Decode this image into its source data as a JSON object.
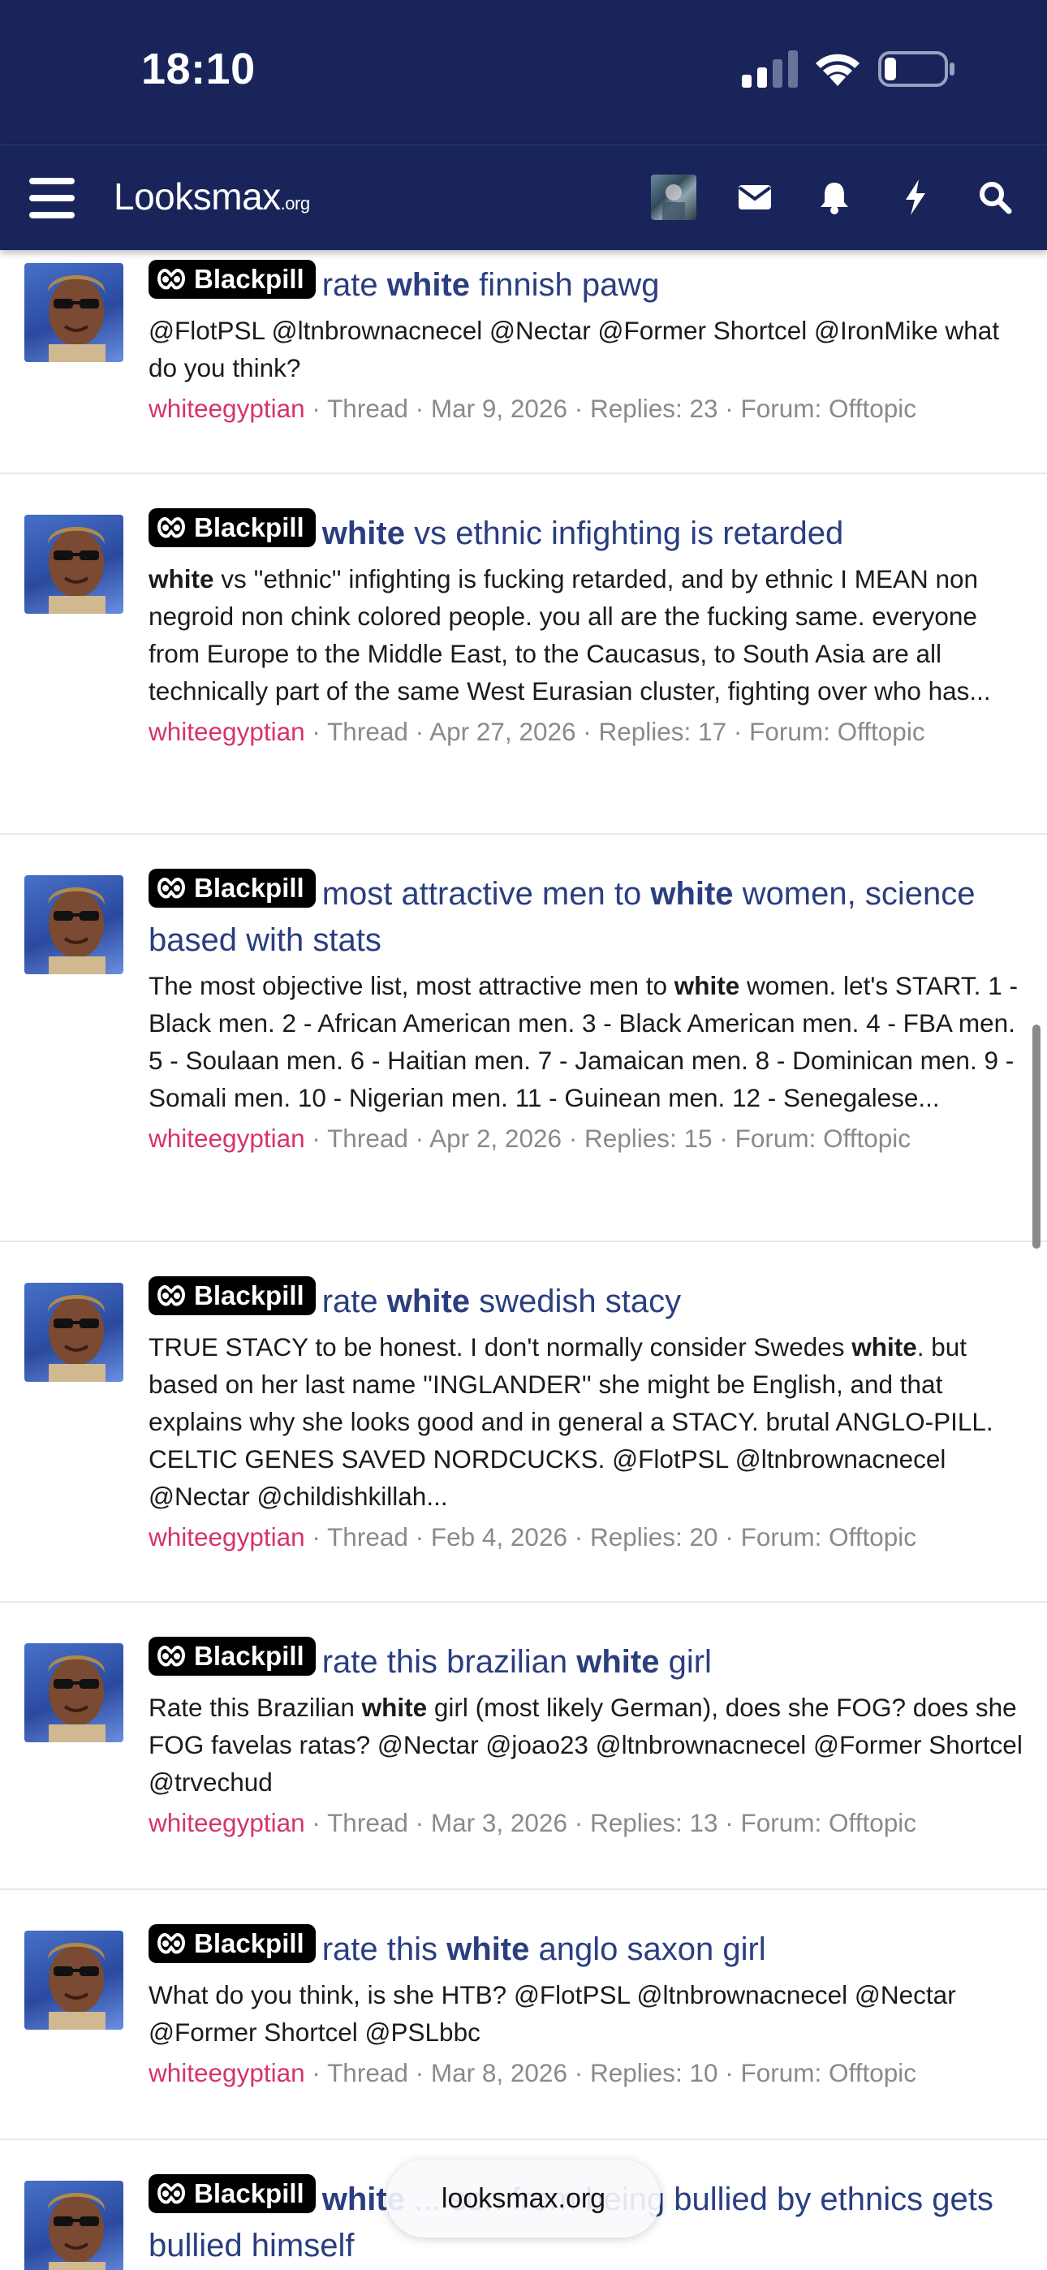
{
  "status": {
    "time": "18:10"
  },
  "header": {
    "logo_main": "Looksmax",
    "logo_suffix": ".org"
  },
  "tag_label": "Blackpill",
  "items": [
    {
      "title": [
        {
          "t": "rate "
        },
        {
          "t": "white",
          "b": true
        },
        {
          "t": " finnish pawg"
        }
      ],
      "snippet": [
        {
          "t": "@FlotPSL @ltnbrownacnecel @Nectar @Former Shortcel @IronMike what do you think?"
        }
      ],
      "author": "whiteegyptian",
      "meta": " · Thread · Mar 9, 2026 · Replies: 23 · Forum: Offtopic"
    },
    {
      "title": [
        {
          "t": "white",
          "b": true
        },
        {
          "t": " vs ethnic infighting is retarded"
        }
      ],
      "snippet": [
        {
          "t": "white",
          "b": true
        },
        {
          "t": " vs ''ethnic'' infighting is fucking retarded, and by ethnic I MEAN non negroid non chink colored people. you all are the fucking same. everyone from Europe to the Middle East, to the Caucasus, to South Asia are all technically part of the same West Eurasian cluster, fighting over who has..."
        }
      ],
      "author": "whiteegyptian",
      "meta": " · Thread · Apr 27, 2026 · Replies: 17 · Forum: Offtopic"
    },
    {
      "title": [
        {
          "t": "most attractive men to "
        },
        {
          "t": "white",
          "b": true
        },
        {
          "t": " women, science based with stats"
        }
      ],
      "snippet": [
        {
          "t": "The most objective list, most attractive men to "
        },
        {
          "t": "white",
          "b": true
        },
        {
          "t": " women. let's START. 1 - Black men. 2 - African American men. 3 - Black American men. 4 - FBA men. 5 - Soulaan men. 6 - Haitian men. 7 - Jamaican men. 8 - Dominican men. 9 - Somali men. 10 - Nigerian men. 11 - Guinean men. 12 - Senegalese..."
        }
      ],
      "author": "whiteegyptian",
      "meta": " · Thread · Apr 2, 2026 · Replies: 15 · Forum: Offtopic"
    },
    {
      "title": [
        {
          "t": "rate "
        },
        {
          "t": "white",
          "b": true
        },
        {
          "t": " swedish stacy"
        }
      ],
      "snippet": [
        {
          "t": "TRUE STACY to be honest. I don't normally consider Swedes "
        },
        {
          "t": "white",
          "b": true
        },
        {
          "t": ". but based on her last name ''INGLANDER'' she might be English, and that explains why she looks good and in general a STACY. brutal ANGLO-PILL. CELTIC GENES SAVED NORDCUCKS. @FlotPSL @ltnbrownacnecel @Nectar @childishkillah..."
        }
      ],
      "author": "whiteegyptian",
      "meta": " · Thread · Feb 4, 2026 · Replies: 20 · Forum: Offtopic"
    },
    {
      "title": [
        {
          "t": "rate this brazilian "
        },
        {
          "t": "white",
          "b": true
        },
        {
          "t": " girl"
        }
      ],
      "snippet": [
        {
          "t": "Rate this Brazilian "
        },
        {
          "t": "white",
          "b": true
        },
        {
          "t": " girl (most likely German), does she FOG? does she FOG favelas ratas? @Nectar @joao23 @ltnbrownacnecel @Former Shortcel @trvechud"
        }
      ],
      "author": "whiteegyptian",
      "meta": " · Thread · Mar 3, 2026 · Replies: 13 · Forum: Offtopic"
    },
    {
      "title": [
        {
          "t": "rate this "
        },
        {
          "t": "white",
          "b": true
        },
        {
          "t": " anglo saxon girl"
        }
      ],
      "snippet": [
        {
          "t": "What do you think, is she HTB? @FlotPSL @ltnbrownacnecel @Nectar @Former Shortcel @PSLbbc"
        }
      ],
      "author": "whiteegyptian",
      "meta": " · Thread · Mar 8, 2026 · Replies: 10 · Forum: Offtopic"
    },
    {
      "title": [
        {
          "t": "white",
          "b": true
        },
        {
          "t": " ... son from being bullied by ethnics gets bullied himself"
        }
      ],
      "snippet": [],
      "author": "",
      "meta": ""
    }
  ],
  "url_pill": "looksmax.org"
}
